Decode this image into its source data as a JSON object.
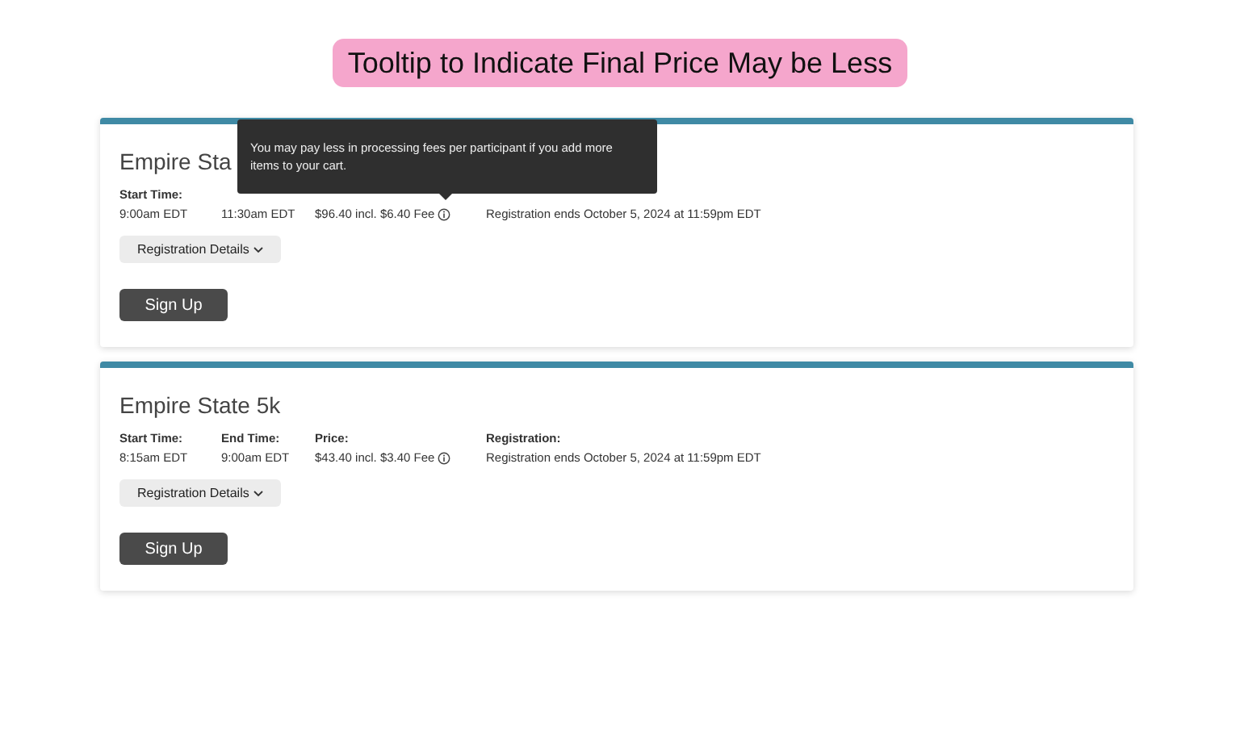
{
  "heading": "Tooltip to Indicate Final Price May be Less",
  "events": [
    {
      "title": "Empire Sta",
      "fields": [
        {
          "label": "Start Time:",
          "value": "9:00am EDT"
        },
        {
          "value": "11:30am EDT"
        },
        {
          "value": "$96.40 incl. $6.40 Fee",
          "kind": "price"
        },
        {
          "value": "Registration ends October 5, 2024 at 11:59pm EDT"
        }
      ],
      "details_button": "Registration Details",
      "signup_button": "Sign Up",
      "tooltip": "You may pay less in processing fees per participant if you add more items to your cart."
    },
    {
      "title": "Empire State 5k",
      "fields": [
        {
          "label": "Start Time:",
          "value": "8:15am EDT"
        },
        {
          "label": "End Time:",
          "value": "9:00am EDT"
        },
        {
          "label": "Price:",
          "value": "$43.40 incl. $3.40 Fee",
          "kind": "price"
        },
        {
          "label": "Registration:",
          "value": "Registration ends October 5, 2024 at 11:59pm EDT"
        }
      ],
      "details_button": "Registration Details",
      "signup_button": "Sign Up"
    }
  ]
}
